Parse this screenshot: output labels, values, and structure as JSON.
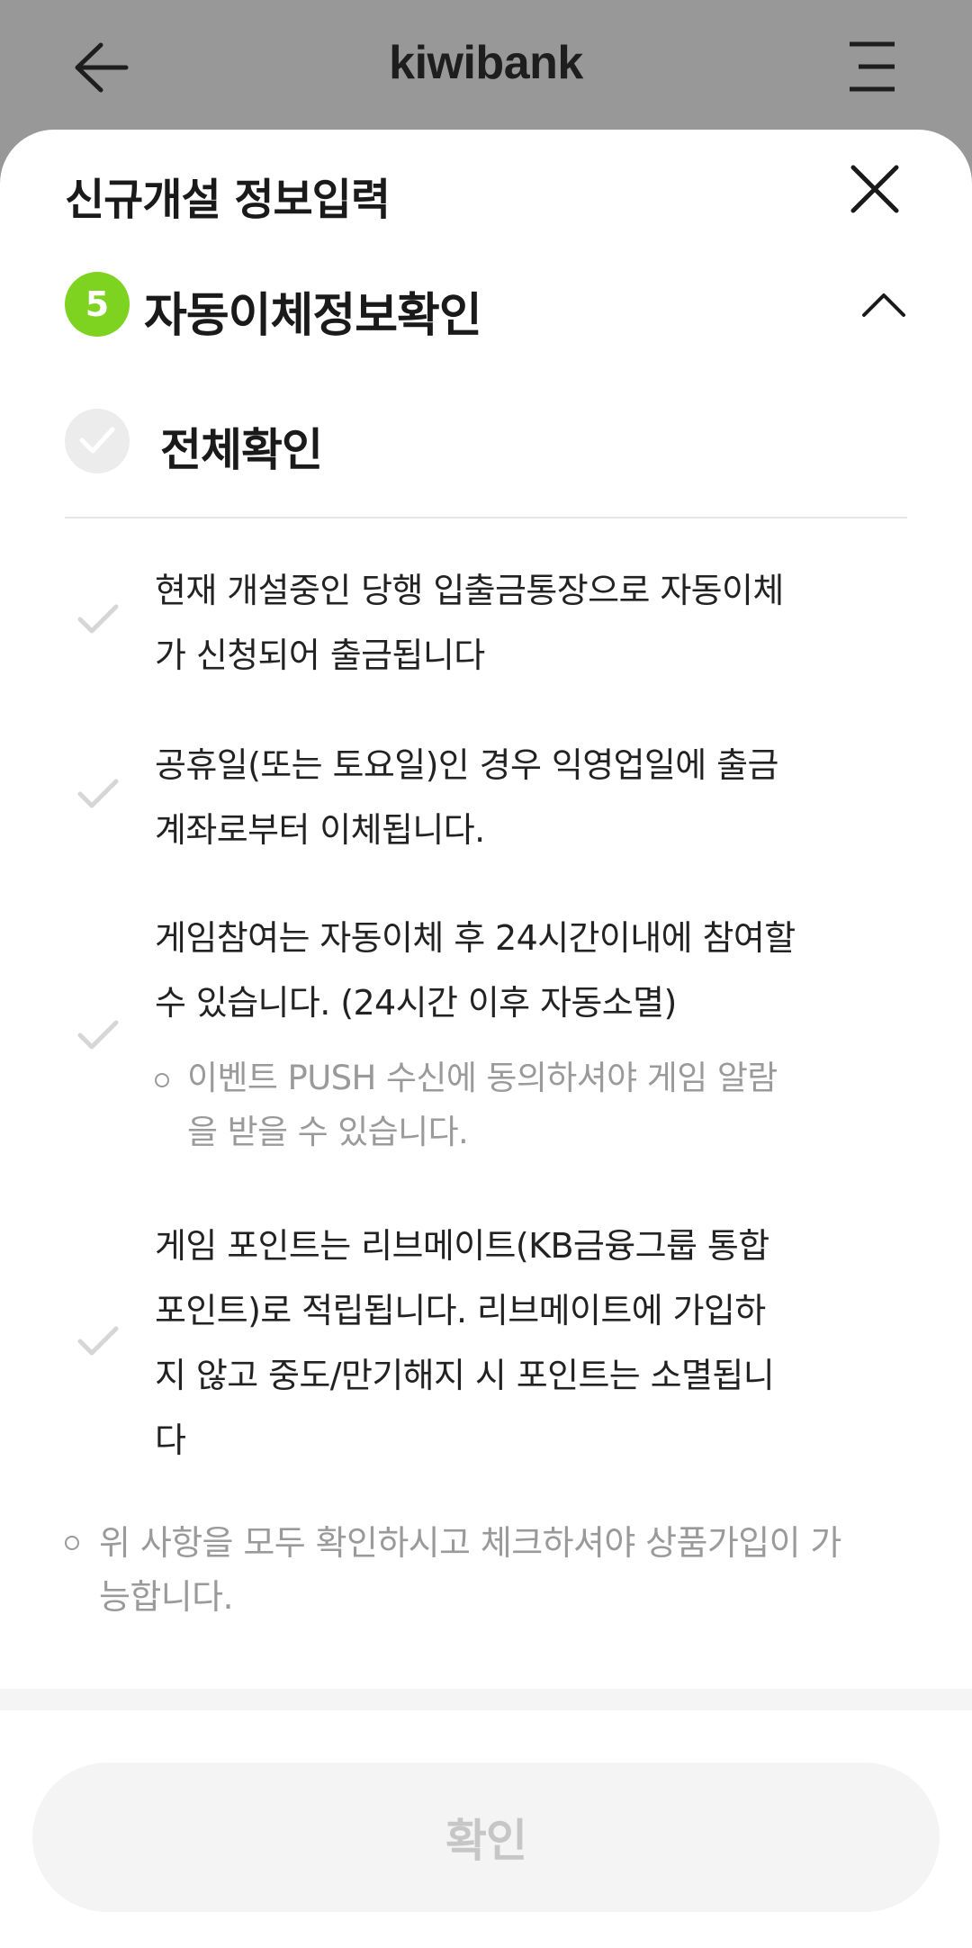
{
  "header": {
    "title": "kiwibank",
    "back_icon": "back-arrow-icon",
    "menu_icon": "menu-icon"
  },
  "sheet": {
    "title": "신규개설 정보입력",
    "close_icon": "close-icon"
  },
  "step": {
    "number": "5",
    "title": "자동이체정보확인",
    "badge_color": "#7ED321",
    "toggle_icon": "chevron-up-icon"
  },
  "all_check": {
    "label": "전체확인",
    "checked": false
  },
  "items": [
    {
      "lines": [
        "현재 개설중인 당행 입출금통장으로 자동이체",
        "가 신청되어 출금됩니다"
      ],
      "checked": false
    },
    {
      "lines": [
        "공휴일(또는 토요일)인 경우 익영업일에 출금",
        "계좌로부터 이체됩니다."
      ],
      "checked": false
    },
    {
      "lines": [
        "게임참여는 자동이체 후 24시간이내에 참여할",
        "수 있습니다. (24시간 이후 자동소멸)"
      ],
      "sub_lines": [
        "이벤트 PUSH 수신에 동의하셔야 게임 알람",
        "을 받을 수 있습니다."
      ],
      "checked": false
    },
    {
      "lines": [
        "게임 포인트는 리브메이트(KB금융그룹 통합",
        "포인트)로 적립됩니다. 리브메이트에 가입하",
        "지 않고 중도/만기해지 시 포인트는 소멸됩니",
        "다"
      ],
      "checked": false
    }
  ],
  "notice": {
    "lines": [
      "위 사항을 모두 확인하시고 체크하셔야 상품가입이 가",
      "능합니다."
    ]
  },
  "confirm_button": {
    "label": "확인",
    "enabled": false
  }
}
